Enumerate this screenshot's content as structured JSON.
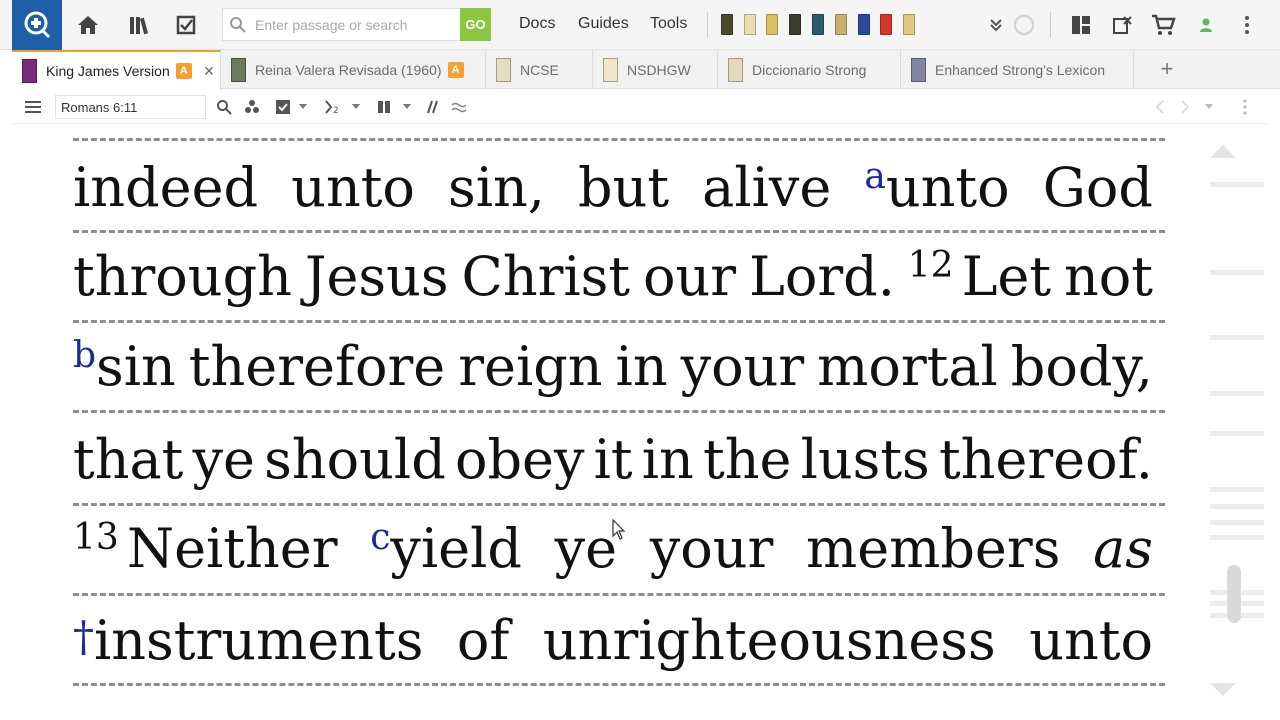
{
  "toolbar": {
    "search_placeholder": "Enter passage or search",
    "go_label": "GO",
    "menu": [
      "Docs",
      "Guides",
      "Tools"
    ]
  },
  "tabs": [
    {
      "label": "King James Version",
      "badge": "A",
      "active": true,
      "book_color": "#7a2a7a"
    },
    {
      "label": "Reina Valera Revisada (1960)",
      "badge": "A",
      "active": false,
      "book_color": "#6a7a5a"
    },
    {
      "label": "NCSE",
      "badge": "",
      "active": false,
      "book_color": "#e6dcc0"
    },
    {
      "label": "NSDHGW",
      "badge": "",
      "active": false,
      "book_color": "#efe6cc"
    },
    {
      "label": "Diccionario Strong",
      "badge": "",
      "active": false,
      "book_color": "#e3dabd"
    },
    {
      "label": "Enhanced Strong's Lexicon",
      "badge": "",
      "active": false,
      "book_color": "#7e86a3"
    }
  ],
  "panel": {
    "reference": "Romans 6:11"
  },
  "text": {
    "l1": [
      "indeed",
      "unto",
      "sin,",
      "but",
      "alive"
    ],
    "l1_fn": "a",
    "l1_end": [
      "unto",
      "God"
    ],
    "l2": [
      "through",
      "Jesus",
      "Christ",
      "our",
      "Lord."
    ],
    "l2_vn": "12",
    "l2_end": [
      "Let",
      "not"
    ],
    "l3_fn": "b",
    "l3": [
      "sin",
      "therefore",
      "reign",
      "in",
      "your",
      "mortal",
      "body,"
    ],
    "l4": [
      "that",
      "ye",
      "should",
      "obey",
      "it",
      "in",
      "the",
      "lusts",
      "thereof."
    ],
    "l5_vn": "13",
    "l5": [
      "Neither"
    ],
    "l5_fn": "c",
    "l5_end": [
      "yield",
      "ye",
      "your",
      "members"
    ],
    "l5_it": "as",
    "l6_mark": "†",
    "l6": [
      "instruments",
      "of",
      "unrighteousness",
      "unto"
    ]
  },
  "colors": {
    "accent": "#f0a030",
    "go": "#8cc63f",
    "logo": "#1f5fa8",
    "footnote": "#1a2a9c"
  }
}
